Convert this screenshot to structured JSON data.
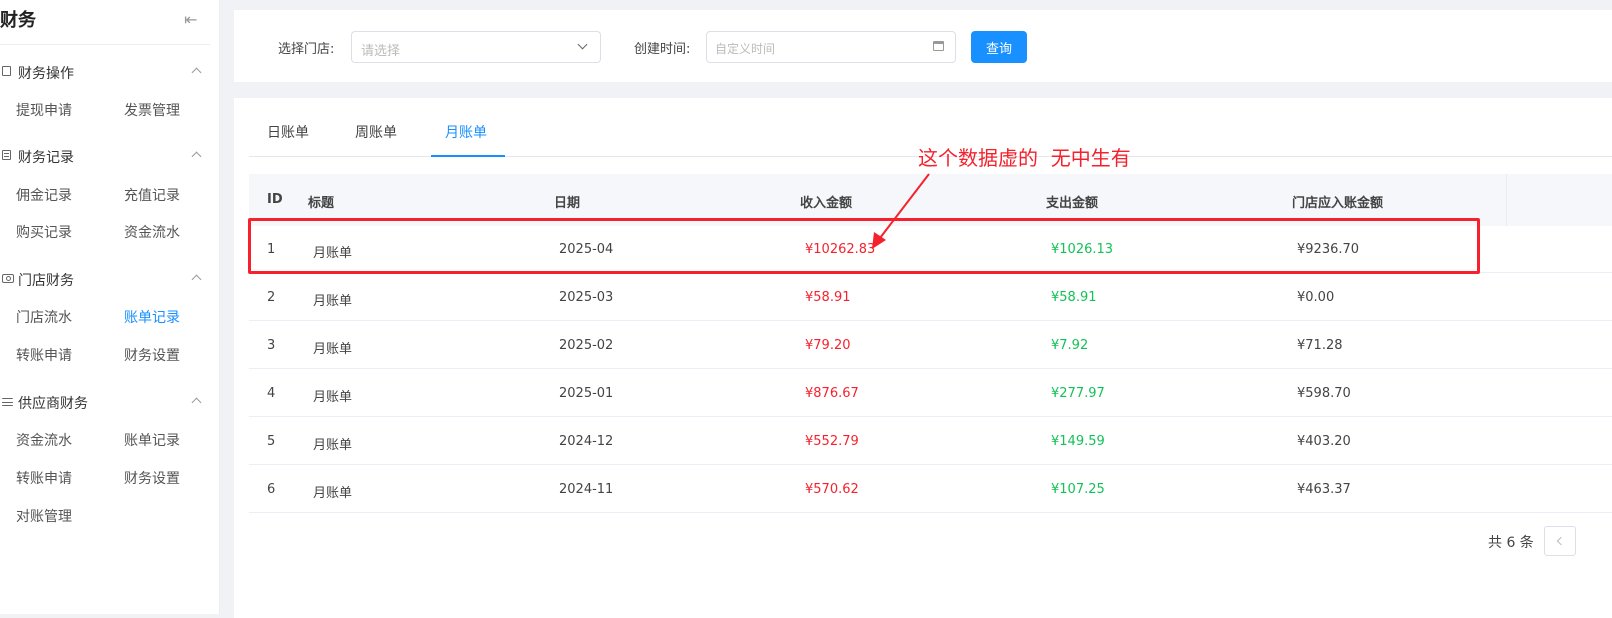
{
  "sidebar": {
    "title": "财务",
    "groups": [
      {
        "label": "财务操作",
        "items": [
          "提现申请",
          "发票管理"
        ]
      },
      {
        "label": "财务记录",
        "items": [
          "佣金记录",
          "充值记录",
          "购买记录",
          "资金流水"
        ]
      },
      {
        "label": "门店财务",
        "items": [
          "门店流水",
          "账单记录",
          "转账申请",
          "财务设置"
        ]
      },
      {
        "label": "供应商财务",
        "items": [
          "资金流水",
          "账单记录",
          "转账申请",
          "财务设置",
          "对账管理"
        ]
      }
    ],
    "active_item": "账单记录",
    "icons": [
      "clipboard-icon",
      "document-icon",
      "money-icon",
      "list-icon",
      "collapse-icon",
      "chevron-up-icon"
    ]
  },
  "filter": {
    "store_label": "选择门店:",
    "store_placeholder": "请选择",
    "time_label": "创建时间:",
    "time_placeholder": "自定义时间",
    "query_button": "查询"
  },
  "tabs": [
    {
      "label": "日账单"
    },
    {
      "label": "周账单"
    },
    {
      "label": "月账单"
    }
  ],
  "active_tab": "月账单",
  "table": {
    "headers": [
      "ID",
      "标题",
      "日期",
      "收入金额",
      "支出金额",
      "门店应入账金额"
    ],
    "rows": [
      {
        "id": "1",
        "title": "月账单",
        "date": "2025-04",
        "income": "¥10262.83",
        "expense": "¥1026.13",
        "net": "¥9236.70"
      },
      {
        "id": "2",
        "title": "月账单",
        "date": "2025-03",
        "income": "¥58.91",
        "expense": "¥58.91",
        "net": "¥0.00"
      },
      {
        "id": "3",
        "title": "月账单",
        "date": "2025-02",
        "income": "¥79.20",
        "expense": "¥7.92",
        "net": "¥71.28"
      },
      {
        "id": "4",
        "title": "月账单",
        "date": "2025-01",
        "income": "¥876.67",
        "expense": "¥277.97",
        "net": "¥598.70"
      },
      {
        "id": "5",
        "title": "月账单",
        "date": "2024-12",
        "income": "¥552.79",
        "expense": "¥149.59",
        "net": "¥403.20"
      },
      {
        "id": "6",
        "title": "月账单",
        "date": "2024-11",
        "income": "¥570.62",
        "expense": "¥107.25",
        "net": "¥463.37"
      }
    ]
  },
  "pagination": {
    "total_text": "共 6 条"
  },
  "annotation": {
    "text": "这个数据虚的  无中生有"
  },
  "colors": {
    "accent": "#1890ff",
    "income": "#f5222d",
    "expense": "#13c257",
    "annotation": "#f5222d"
  }
}
